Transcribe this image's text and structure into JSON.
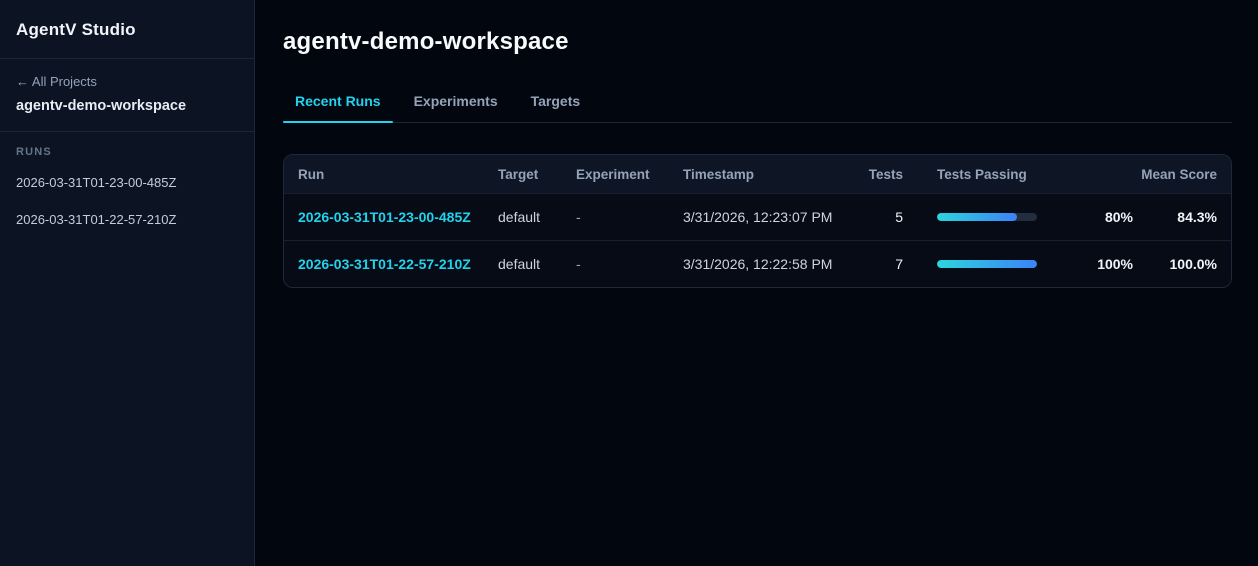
{
  "app": {
    "title": "AgentV Studio"
  },
  "colors": {
    "accent_cyan": "#22d3ee",
    "accent_blue": "#3b82f6",
    "sidebar_bg": "#0c1322",
    "main_bg": "#02060f",
    "table_header_bg": "#0e1626",
    "row_bg": "#060b15",
    "border": "#1e293b"
  },
  "sidebar": {
    "back_link": "← All Projects",
    "workspace_name": "agentv-demo-workspace",
    "runs_label": "RUNS",
    "runs": [
      "2026-03-31T01-23-00-485Z",
      "2026-03-31T01-22-57-210Z"
    ]
  },
  "main": {
    "title": "agentv-demo-workspace",
    "tabs": [
      {
        "label": "Recent Runs",
        "active": true
      },
      {
        "label": "Experiments",
        "active": false
      },
      {
        "label": "Targets",
        "active": false
      }
    ]
  },
  "table": {
    "columns": {
      "run": "Run",
      "target": "Target",
      "experiment": "Experiment",
      "timestamp": "Timestamp",
      "tests": "Tests",
      "tests_passing": "Tests Passing",
      "mean_score": "Mean Score"
    },
    "rows": [
      {
        "run": "2026-03-31T01-23-00-485Z",
        "target": "default",
        "experiment": "-",
        "timestamp": "3/31/2026, 12:23:07 PM",
        "tests": "5",
        "passing_value": 80,
        "passing_pct": "80%",
        "mean_score": "84.3%"
      },
      {
        "run": "2026-03-31T01-22-57-210Z",
        "target": "default",
        "experiment": "-",
        "timestamp": "3/31/2026, 12:22:58 PM",
        "tests": "7",
        "passing_value": 100,
        "passing_pct": "100%",
        "mean_score": "100.0%"
      }
    ]
  }
}
